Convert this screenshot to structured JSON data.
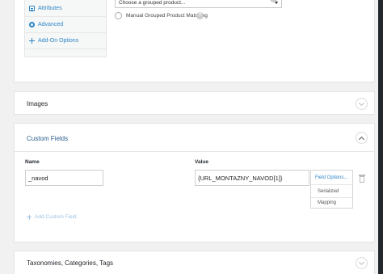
{
  "product_data": {
    "tabs": [
      {
        "label": "Attributes",
        "icon": "attributes-icon"
      },
      {
        "label": "Advanced",
        "icon": "gear-icon"
      },
      {
        "label": "Add-On Options",
        "icon": "plus-icon"
      }
    ],
    "grouped_select": {
      "value": "Choose a grouped product..."
    },
    "manual_matching_label": "Manual Grouped Product Matching",
    "help_glyph": "?"
  },
  "images_panel": {
    "title": "Images"
  },
  "custom_fields": {
    "title": "Custom Fields",
    "name_header": "Name",
    "value_header": "Value",
    "row": {
      "name": "_navod",
      "value": "{URL_MONTAZNY_NAVOD[1]}"
    },
    "field_options": {
      "label": "Field Options...",
      "items": [
        "Serialized",
        "Mapping"
      ]
    },
    "add_label": "Add Custom Field"
  },
  "taxonomies_panel": {
    "title": "Taxonomies, Categories, Tags"
  },
  "colors": {
    "accent": "#2f86c6",
    "page_bg": "#f1f1f1",
    "admin_bar": "#23282d"
  }
}
